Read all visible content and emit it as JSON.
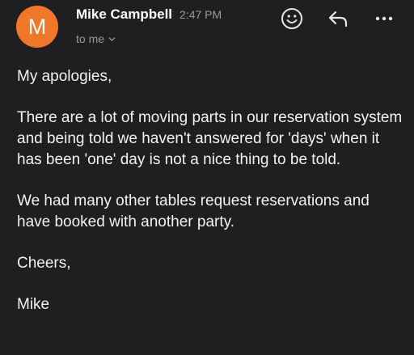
{
  "header": {
    "avatar_initial": "M",
    "avatar_color": "#f0772a",
    "sender_name": "Mike Campbell",
    "time": "2:47 PM",
    "recipient_label": "to me",
    "actions": [
      "emoji-reaction-icon",
      "reply-icon",
      "more-options-icon"
    ]
  },
  "body": {
    "paragraphs": [
      "My apologies,",
      "There are a lot of moving parts in our reservation system and being told we haven't answered for 'days' when it has been 'one' day is not a nice thing to be told.",
      "We had many other tables request reservations and have booked with another party.",
      "Cheers,",
      "Mike"
    ]
  }
}
